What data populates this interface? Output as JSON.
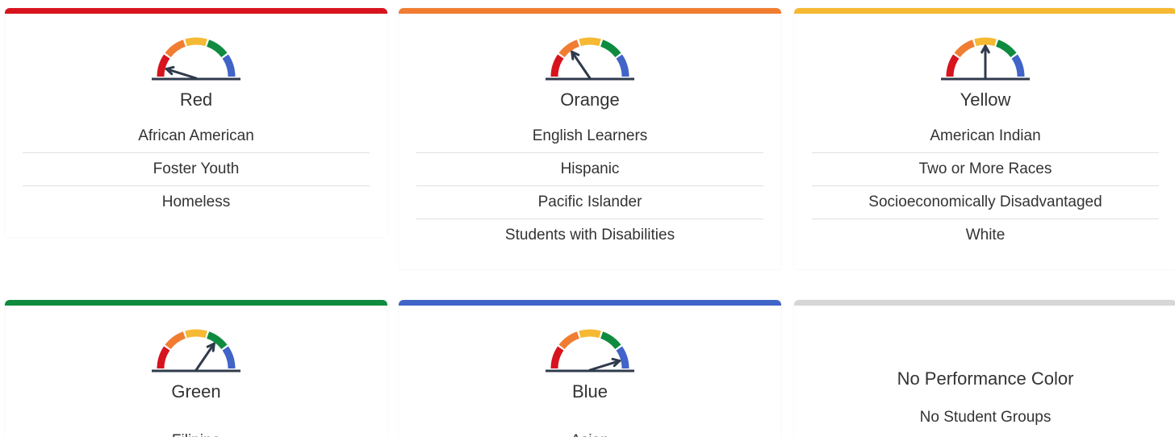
{
  "colors": {
    "red": "#d7141e",
    "orange": "#f07d32",
    "yellow": "#f5b933",
    "green": "#0f8b3f",
    "blue": "#4164c8",
    "gray": "#d6d6d6",
    "needle": "#2f3a4c"
  },
  "cards": [
    {
      "level": "Red",
      "accent": "#d7141e",
      "needle_value": 0.08,
      "groups": [
        "African American",
        "Foster Youth",
        "Homeless"
      ]
    },
    {
      "level": "Orange",
      "accent": "#f07d32",
      "needle_value": 0.3,
      "groups": [
        "English Learners",
        "Hispanic",
        "Pacific Islander",
        "Students with Disabilities"
      ]
    },
    {
      "level": "Yellow",
      "accent": "#f5b933",
      "needle_value": 0.5,
      "groups": [
        "American Indian",
        "Two or More Races",
        "Socioeconomically Disadvantaged",
        "White"
      ]
    },
    {
      "level": "Green",
      "accent": "#0f8b3f",
      "needle_value": 0.7,
      "groups": [
        "Filipino"
      ]
    },
    {
      "level": "Blue",
      "accent": "#4164c8",
      "needle_value": 0.92,
      "groups": [
        "Asian"
      ]
    }
  ],
  "no_color_card": {
    "title": "No Performance Color",
    "subtitle": "No Student Groups",
    "accent": "#d6d6d6"
  }
}
